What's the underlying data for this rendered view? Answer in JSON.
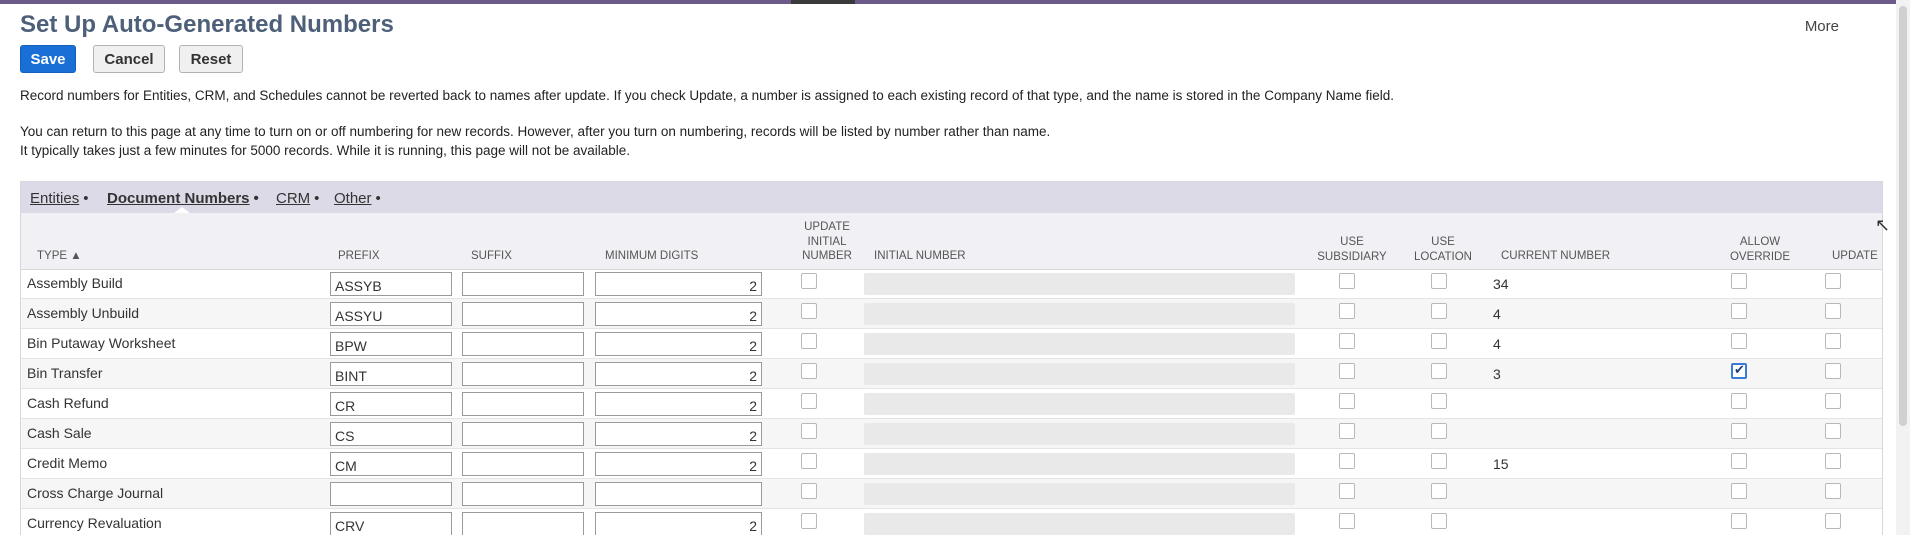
{
  "page": {
    "title": "Set Up Auto-Generated Numbers",
    "more_label": "More"
  },
  "toolbar": {
    "save_label": "Save",
    "cancel_label": "Cancel",
    "reset_label": "Reset"
  },
  "info": {
    "line1": "Record numbers for Entities, CRM, and Schedules cannot be reverted back to names after update. If you check Update, a number is assigned to each existing record of that type, and the name is stored in the Company Name field.",
    "line2": "You can return to this page at any time to turn on or off numbering for new records. However, after you turn on numbering, records will be listed by number rather than name.",
    "line3": "It typically takes just a few minutes for 5000 records. While it is running, this page will not be available."
  },
  "tabs": [
    {
      "label": "Entities",
      "active": false
    },
    {
      "label": "Document Numbers",
      "active": true
    },
    {
      "label": "CRM",
      "active": false
    },
    {
      "label": "Other",
      "active": false
    }
  ],
  "tab_separator": "•",
  "columns": {
    "type": "TYPE ▲",
    "prefix": "PREFIX",
    "suffix": "SUFFIX",
    "min_digits": "MINIMUM DIGITS",
    "update_initial_1": "UPDATE",
    "update_initial_2": "INITIAL",
    "update_initial_3": "NUMBER",
    "initial_number": "INITIAL NUMBER",
    "use_subsidiary_1": "USE",
    "use_subsidiary_2": "SUBSIDIARY",
    "use_location_1": "USE",
    "use_location_2": "LOCATION",
    "current_number": "CURRENT NUMBER",
    "allow_override_1": "ALLOW",
    "allow_override_2": "OVERRIDE",
    "update": "UPDATE"
  },
  "rows": [
    {
      "type": "Assembly Build",
      "prefix": "ASSYB",
      "suffix": "",
      "min_digits": "2",
      "current_number": "34",
      "allow_override": false
    },
    {
      "type": "Assembly Unbuild",
      "prefix": "ASSYU",
      "suffix": "",
      "min_digits": "2",
      "current_number": "4",
      "allow_override": false
    },
    {
      "type": "Bin Putaway Worksheet",
      "prefix": "BPW",
      "suffix": "",
      "min_digits": "2",
      "current_number": "4",
      "allow_override": false
    },
    {
      "type": "Bin Transfer",
      "prefix": "BINT",
      "suffix": "",
      "min_digits": "2",
      "current_number": "3",
      "allow_override": true
    },
    {
      "type": "Cash Refund",
      "prefix": "CR",
      "suffix": "",
      "min_digits": "2",
      "current_number": "",
      "allow_override": false
    },
    {
      "type": "Cash Sale",
      "prefix": "CS",
      "suffix": "",
      "min_digits": "2",
      "current_number": "",
      "allow_override": false
    },
    {
      "type": "Credit Memo",
      "prefix": "CM",
      "suffix": "",
      "min_digits": "2",
      "current_number": "15",
      "allow_override": false
    },
    {
      "type": "Cross Charge Journal",
      "prefix": "",
      "suffix": "",
      "min_digits": "",
      "current_number": "",
      "allow_override": false
    },
    {
      "type": "Currency Revaluation",
      "prefix": "CRV",
      "suffix": "",
      "min_digits": "2",
      "current_number": "",
      "allow_override": false
    }
  ]
}
